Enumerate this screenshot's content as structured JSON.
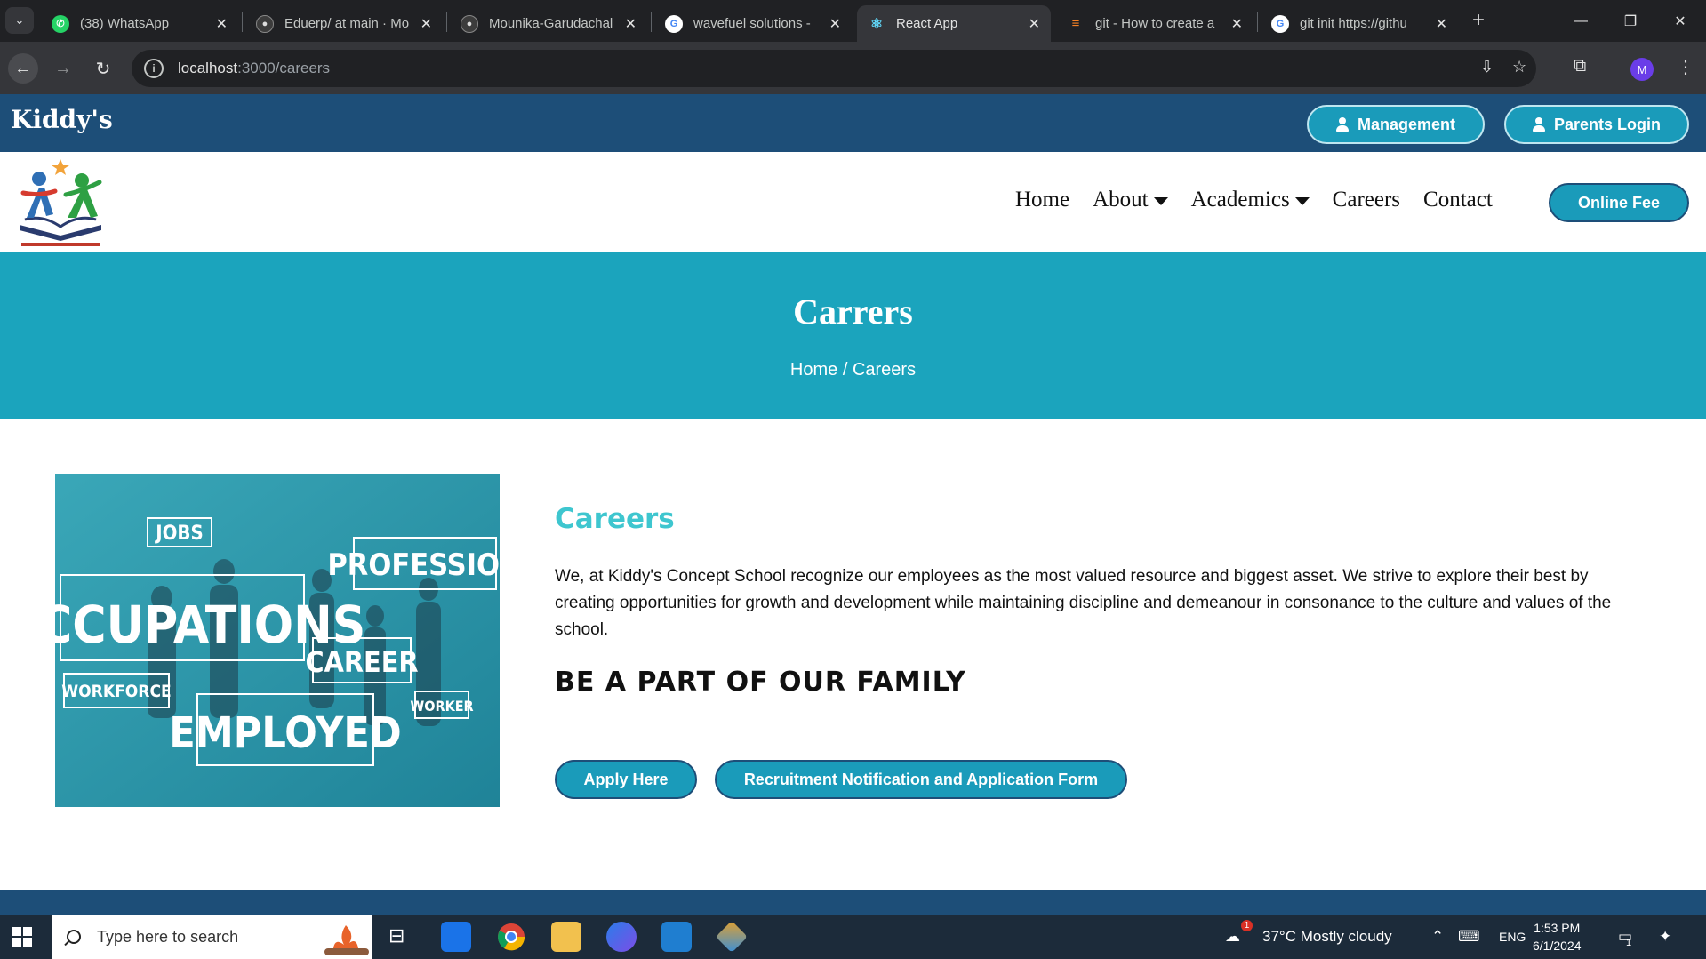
{
  "browser": {
    "tabs": [
      {
        "title": "(38) WhatsApp",
        "favicon": "whatsapp-icon",
        "active": false
      },
      {
        "title": "Eduerp/ at main · Mo",
        "favicon": "github-icon",
        "active": false
      },
      {
        "title": "Mounika-Garudachal",
        "favicon": "github-icon",
        "active": false
      },
      {
        "title": "wavefuel solutions -",
        "favicon": "google-icon",
        "active": false
      },
      {
        "title": "React App",
        "favicon": "react-icon",
        "active": true
      },
      {
        "title": "git - How to create a",
        "favicon": "stackoverflow-icon",
        "active": false
      },
      {
        "title": "git init https://githu",
        "favicon": "google-icon",
        "active": false
      }
    ],
    "url_host": "localhost",
    "url_path": ":3000/careers",
    "profile_initial": "M"
  },
  "site": {
    "brand": "Kiddy's",
    "management_label": "Management",
    "parents_login_label": "Parents Login",
    "nav": {
      "home": "Home",
      "about": "About",
      "academics": "Academics",
      "careers": "Careers",
      "contact": "Contact"
    },
    "online_fee_label": "Online Fee"
  },
  "hero": {
    "title": "Carrers",
    "breadcrumb": "Home / Careers"
  },
  "content": {
    "image_words": [
      "JOBS",
      "PROFESSION",
      "OCCUPATIONS",
      "CAREER",
      "WORKFORCE",
      "WORKER",
      "EMPLOYED"
    ],
    "heading": "Careers",
    "intro": "We, at Kiddy's Concept School recognize our employees as the most valued resource and biggest asset. We strive to explore their best by creating opportunities for growth and development while maintaining discipline and demeanour in consonance to the culture and values of the school.",
    "tagline": "BE A PART OF OUR FAMILY",
    "apply_label": "Apply Here",
    "recruitment_label": "Recruitment Notification and Application Form"
  },
  "taskbar": {
    "search_placeholder": "Type here to search",
    "weather": "37°C  Mostly cloudy",
    "weather_badge": "1",
    "language": "ENG",
    "time": "1:53 PM",
    "date": "6/1/2024",
    "notification_count": "1"
  },
  "colors": {
    "topbar": "#1d4e78",
    "accent": "#1a9bba",
    "hero": "#1ba4bd",
    "careers_heading": "#3ec6cf"
  }
}
